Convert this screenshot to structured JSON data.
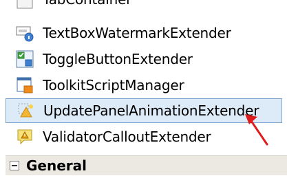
{
  "toolbox": {
    "items": [
      {
        "label": "TabContainer",
        "icon": "tab-container-icon"
      },
      {
        "label": "TextBoxWatermarkExtender",
        "icon": "textbox-watermark-icon"
      },
      {
        "label": "ToggleButtonExtender",
        "icon": "toggle-button-icon"
      },
      {
        "label": "ToolkitScriptManager",
        "icon": "script-manager-icon"
      },
      {
        "label": "UpdatePanelAnimationExtender",
        "icon": "update-panel-animation-icon",
        "selected": true
      },
      {
        "label": "ValidatorCalloutExtender",
        "icon": "validator-callout-icon"
      }
    ],
    "group": {
      "label": "General",
      "toggle": "collapse-icon"
    }
  },
  "colors": {
    "selection_bg": "#ddebf8",
    "selection_border": "#7da2ce",
    "group_bg": "#ebe9e2",
    "arrow": "#e01b1b"
  }
}
